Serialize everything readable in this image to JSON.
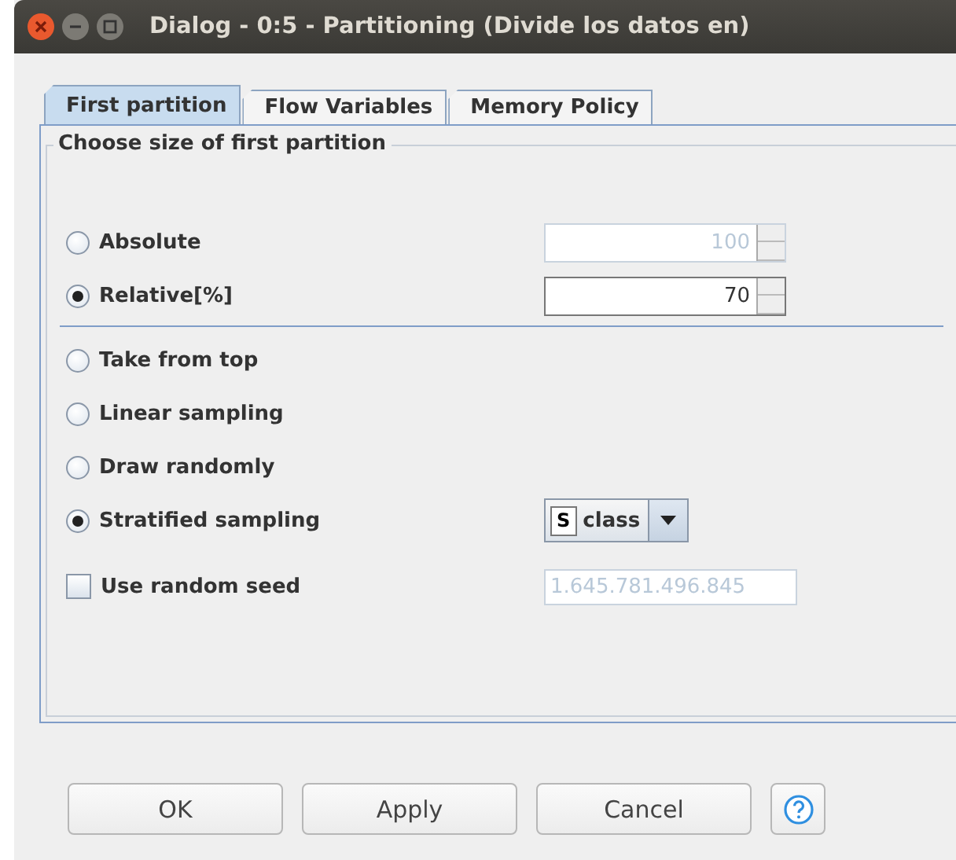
{
  "window": {
    "title": "Dialog - 0:5 - Partitioning (Divide los datos en)"
  },
  "tabs": [
    {
      "label": "First partition",
      "selected": true
    },
    {
      "label": "Flow Variables",
      "selected": false
    },
    {
      "label": "Memory Policy",
      "selected": false
    }
  ],
  "group": {
    "title": "Choose size of first partition"
  },
  "size_options": [
    {
      "label": "Absolute",
      "selected": false,
      "value": "100",
      "disabled": true
    },
    {
      "label": "Relative[%]",
      "selected": true,
      "value": "70",
      "disabled": false
    }
  ],
  "sampling_options": [
    {
      "label": "Take from top",
      "selected": false
    },
    {
      "label": "Linear sampling",
      "selected": false
    },
    {
      "label": "Draw randomly",
      "selected": false
    },
    {
      "label": "Stratified sampling",
      "selected": true
    }
  ],
  "column_select": {
    "type_badge": "S",
    "value": "class"
  },
  "seed": {
    "label": "Use random seed",
    "checked": false,
    "value": "1.645.781.496.845",
    "disabled": true
  },
  "buttons": [
    {
      "label": "OK",
      "kind": "text"
    },
    {
      "label": "Apply",
      "kind": "text"
    },
    {
      "label": "Cancel",
      "kind": "text"
    },
    {
      "kind": "help"
    }
  ]
}
